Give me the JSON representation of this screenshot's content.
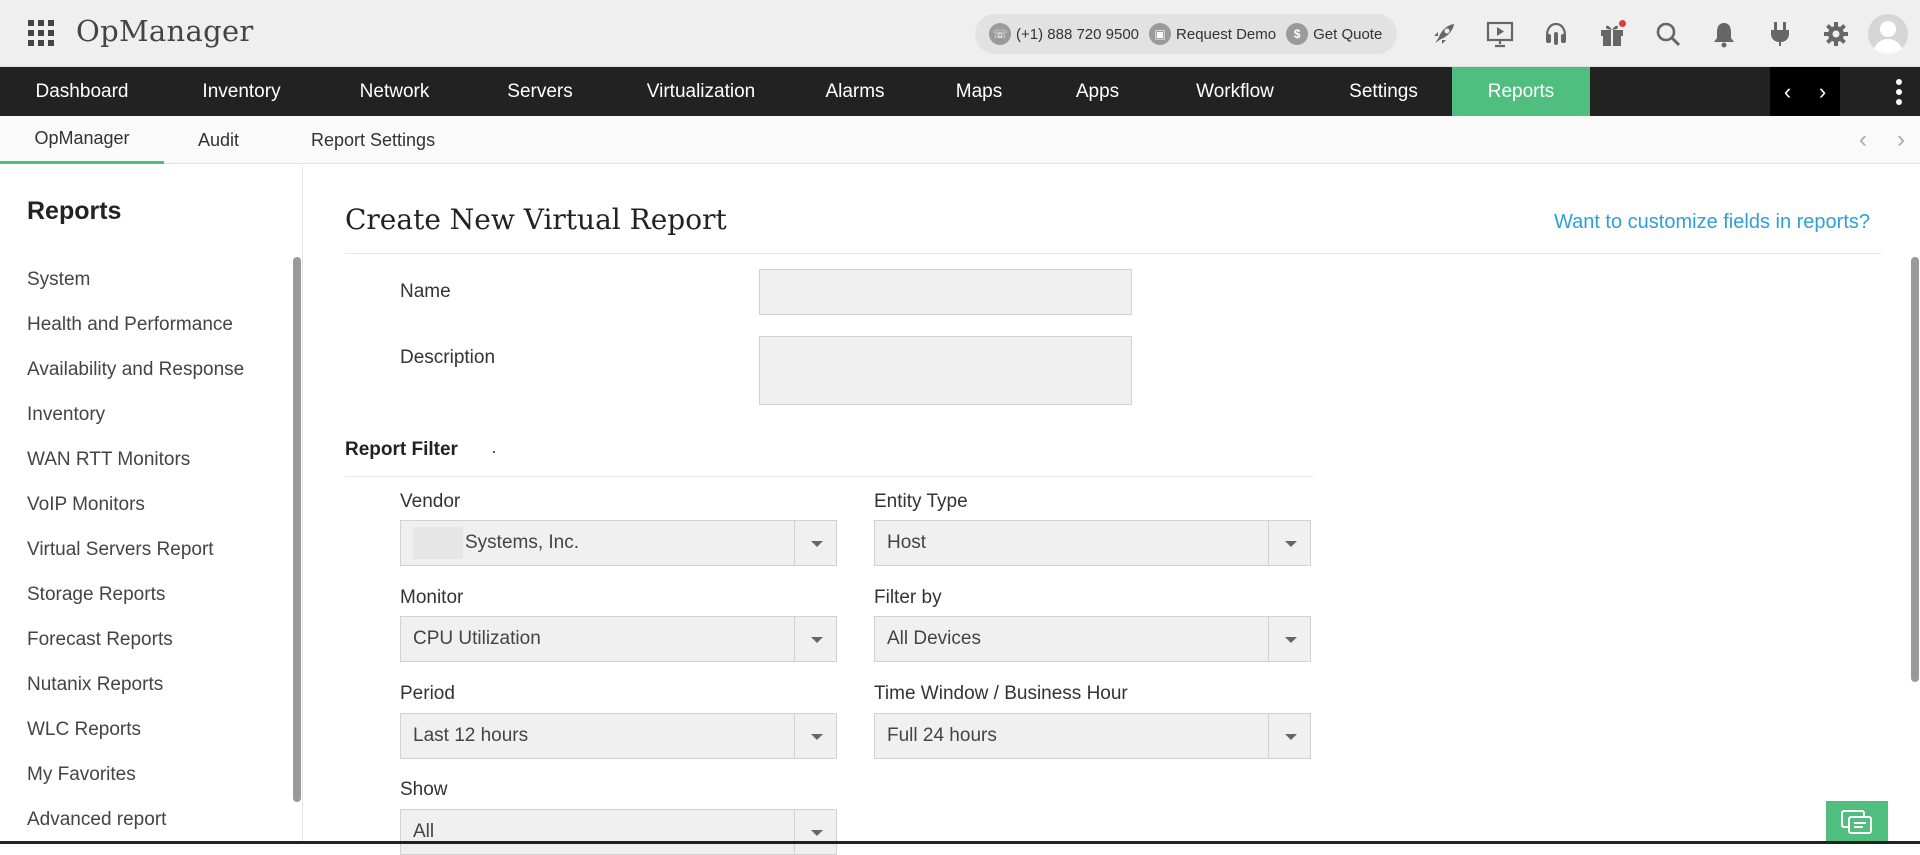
{
  "header": {
    "brand": "OpManager",
    "phone": "(+1) 888 720 9500",
    "request_demo": "Request Demo",
    "get_quote": "Get Quote",
    "icons": [
      "rocket-icon",
      "presentation-icon",
      "headset-icon",
      "gift-icon",
      "search-icon",
      "bell-icon",
      "plug-icon",
      "gear-icon",
      "user-avatar"
    ]
  },
  "main_nav": {
    "items": [
      "Dashboard",
      "Inventory",
      "Network",
      "Servers",
      "Virtualization",
      "Alarms",
      "Maps",
      "Apps",
      "Workflow",
      "Settings",
      "Reports"
    ],
    "active": "Reports",
    "prev": "‹",
    "next": "›"
  },
  "sub_nav": {
    "items": [
      "OpManager",
      "Audit",
      "Report Settings"
    ],
    "active": "OpManager",
    "prev": "‹",
    "next": "›"
  },
  "sidebar": {
    "title": "Reports",
    "items": [
      "System",
      "Health and Performance",
      "Availability and Response",
      "Inventory",
      "WAN RTT Monitors",
      "VoIP Monitors",
      "Virtual Servers Report",
      "Storage Reports",
      "Forecast Reports",
      "Nutanix Reports",
      "WLC Reports",
      "My Favorites",
      "Advanced report"
    ]
  },
  "form": {
    "title": "Create New Virtual Report",
    "customize_link": "Want to customize fields in reports?",
    "name_label": "Name",
    "name_value": "",
    "description_label": "Description",
    "description_value": "",
    "filter_title": "Report Filter",
    "vendor_label": "Vendor",
    "vendor_value": "Systems, Inc.",
    "entity_label": "Entity Type",
    "entity_value": "Host",
    "monitor_label": "Monitor",
    "monitor_value": "CPU Utilization",
    "filterby_label": "Filter by",
    "filterby_value": "All Devices",
    "period_label": "Period",
    "period_value": "Last 12 hours",
    "timewindow_label": "Time Window / Business Hour",
    "timewindow_value": "Full 24 hours",
    "show_label": "Show",
    "show_value": "All"
  },
  "colors": {
    "accent": "#4fbe7f",
    "nav_bg": "#222222",
    "link": "#2f9fd8"
  }
}
